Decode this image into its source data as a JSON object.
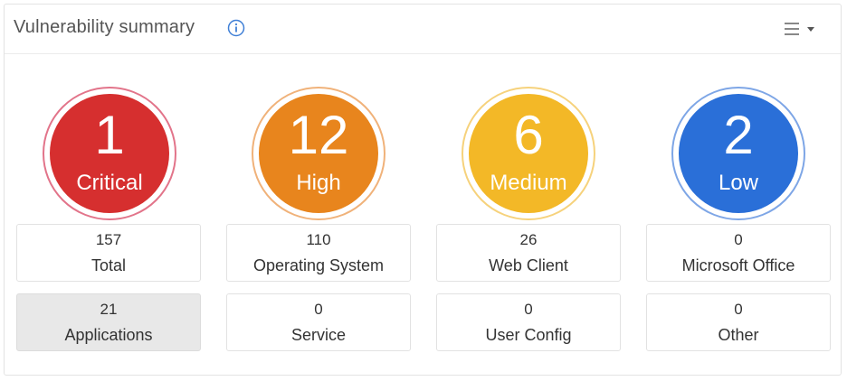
{
  "widget": {
    "title": "Vulnerability summary",
    "info_icon": "info-circle-icon",
    "menu_icon": "hamburger-menu-icon"
  },
  "severities": [
    {
      "count": "1",
      "label": "Critical",
      "color": "#d62f2f",
      "ring": "#e2748a"
    },
    {
      "count": "12",
      "label": "High",
      "color": "#e8851d",
      "ring": "#f0b27a"
    },
    {
      "count": "6",
      "label": "Medium",
      "color": "#f3b827",
      "ring": "#f6d27c"
    },
    {
      "count": "2",
      "label": "Low",
      "color": "#2a6fd8",
      "ring": "#7ea6e6"
    }
  ],
  "categories": [
    {
      "count": "157",
      "label": "Total"
    },
    {
      "count": "110",
      "label": "Operating System"
    },
    {
      "count": "26",
      "label": "Web Client"
    },
    {
      "count": "0",
      "label": "Microsoft Office"
    },
    {
      "count": "21",
      "label": "Applications",
      "selected": true
    },
    {
      "count": "0",
      "label": "Service"
    },
    {
      "count": "0",
      "label": "User Config"
    },
    {
      "count": "0",
      "label": "Other"
    }
  ],
  "colors": {
    "title_text": "#555555",
    "info_icon": "#3f7fd6",
    "selected_tile": "#e8e8e8"
  }
}
